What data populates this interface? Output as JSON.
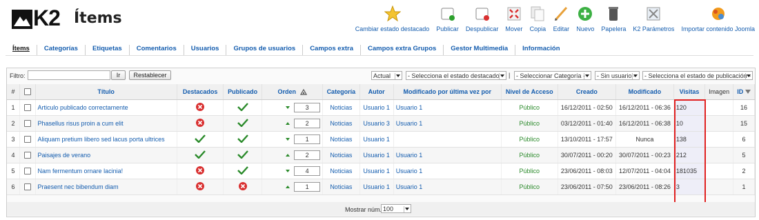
{
  "header": {
    "logo_text": "K2",
    "title": "Ítems"
  },
  "toolbar": [
    {
      "label": "Cambiar estado destacado",
      "icon": "star-icon"
    },
    {
      "label": "Publicar",
      "icon": "publish-icon"
    },
    {
      "label": "Despublicar",
      "icon": "unpublish-icon"
    },
    {
      "label": "Mover",
      "icon": "move-icon"
    },
    {
      "label": "Copia",
      "icon": "copy-icon"
    },
    {
      "label": "Editar",
      "icon": "edit-icon"
    },
    {
      "label": "Nuevo",
      "icon": "new-icon"
    },
    {
      "label": "Papelera",
      "icon": "trash-icon"
    },
    {
      "label": "K2 Parámetros",
      "icon": "parameters-icon"
    },
    {
      "label": "Importar contenido Joomla",
      "icon": "import-icon"
    }
  ],
  "submenu": [
    "Ítems",
    "Categorías",
    "Etiquetas",
    "Comentarios",
    "Usuarios",
    "Grupos de usuarios",
    "Campos extra",
    "Campos extra Grupos",
    "Gestor Multimedia",
    "Información"
  ],
  "filter": {
    "label": "Filtro:",
    "search_value": "",
    "go_label": "Ir",
    "reset_label": "Restablecer",
    "state_select": "Actual",
    "featured_select": "- Selecciona el estado destacado -",
    "separator": "|",
    "category_select": "- Seleccionar Categoría -",
    "user_select": "- Sin usuario -",
    "publish_select": "- Selecciona el estado de publicación -"
  },
  "columns": {
    "num": "#",
    "title": "Título",
    "featured": "Destacados",
    "published": "Publicado",
    "order": "Orden",
    "category": "Categoría",
    "author": "Autor",
    "modified_by": "Modificado por última vez por",
    "access": "Nivel de Acceso",
    "created": "Creado",
    "modified": "Modificado",
    "visits": "Visitas",
    "image": "Imagen",
    "id": "ID"
  },
  "rows": [
    {
      "num": "1",
      "title": "Articulo publicado correctamente",
      "featured": false,
      "published": true,
      "order_arrow": "down",
      "order": "3",
      "category": "Noticias",
      "author": "Usuario 1",
      "modified_by": "Usuario 1",
      "access": "Público",
      "created": "16/12/2011 - 02:50",
      "modified": "16/12/2011 - 06:36",
      "visits": "120",
      "image": "",
      "id": "16"
    },
    {
      "num": "2",
      "title": "Phasellus risus proin a cum elit",
      "featured": false,
      "published": true,
      "order_arrow": "up",
      "order": "2",
      "category": "Noticias",
      "author": "Usuario 3",
      "modified_by": "Usuario 1",
      "access": "Público",
      "created": "03/12/2011 - 01:40",
      "modified": "16/12/2011 - 06:38",
      "visits": "10",
      "image": "",
      "id": "15"
    },
    {
      "num": "3",
      "title": "Aliquam pretium libero sed lacus porta ultrices",
      "featured": true,
      "published": true,
      "order_arrow": "down",
      "order": "1",
      "category": "Noticias",
      "author": "Usuario 1",
      "modified_by": "",
      "access": "Público",
      "created": "13/10/2011 - 17:57",
      "modified": "Nunca",
      "visits": "138",
      "image": "",
      "id": "6"
    },
    {
      "num": "4",
      "title": "Paisajes de verano",
      "featured": true,
      "published": true,
      "order_arrow": "up",
      "order": "2",
      "category": "Noticias",
      "author": "Usuario 1",
      "modified_by": "Usuario 1",
      "access": "Público",
      "created": "30/07/2011 - 00:20",
      "modified": "30/07/2011 - 00:23",
      "visits": "212",
      "image": "",
      "id": "5"
    },
    {
      "num": "5",
      "title": "Nam fermentum ornare lacinia!",
      "featured": false,
      "published": true,
      "order_arrow": "down",
      "order": "4",
      "category": "Noticias",
      "author": "Usuario 1",
      "modified_by": "Usuario 1",
      "access": "Público",
      "created": "23/06/2011 - 08:03",
      "modified": "12/07/2011 - 04:04",
      "visits": "181035",
      "image": "",
      "id": "2"
    },
    {
      "num": "6",
      "title": "Praesent nec bibendum diam",
      "featured": false,
      "published": false,
      "order_arrow": "up",
      "order": "1",
      "category": "Noticias",
      "author": "Usuario 1",
      "modified_by": "Usuario 1",
      "access": "Público",
      "created": "23/06/2011 - 07:50",
      "modified": "23/06/2011 - 08:26",
      "visits": "3",
      "image": "",
      "id": "1"
    }
  ],
  "footer": {
    "limit_label": "Mostrar núm.",
    "limit_value": "100"
  },
  "colors": {
    "link": "#135cae",
    "ok_green": "#2a8a2a",
    "error_red": "#d93030",
    "highlight": "#e02020"
  }
}
